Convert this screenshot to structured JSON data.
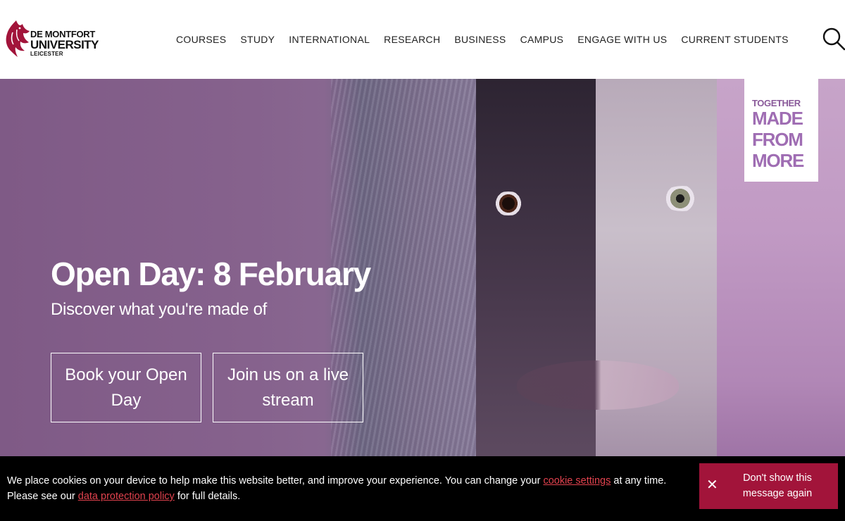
{
  "brand": {
    "line1": "DE MONTFORT",
    "line2": "UNIVERSITY",
    "line3": "LEICESTER",
    "color": "#a2143a"
  },
  "nav": {
    "items": [
      {
        "label": "COURSES"
      },
      {
        "label": "STUDY"
      },
      {
        "label": "INTERNATIONAL"
      },
      {
        "label": "RESEARCH"
      },
      {
        "label": "BUSINESS"
      },
      {
        "label": "CAMPUS"
      },
      {
        "label": "ENGAGE WITH US"
      },
      {
        "label": "CURRENT STUDENTS"
      }
    ],
    "search_icon": "search-icon"
  },
  "hero": {
    "badge": {
      "line1": "TOGETHER",
      "line2": "MADE",
      "line3": "FROM",
      "line4": "MORE"
    },
    "title": "Open Day: 8 February",
    "subtitle": "Discover what you're made of",
    "cta_primary": "Book your Open Day",
    "cta_secondary": "Join us on a live stream"
  },
  "cookie": {
    "text_part1": "We place cookies on your device to help make this website better, and improve your experience. You can change your ",
    "link1": "cookie settings",
    "text_part2": " at any time. Please see our ",
    "link2": "data protection policy",
    "text_part3": " for full details.",
    "dismiss_label": "Don't show this message again",
    "dismiss_icon": "close-icon",
    "accent_color": "#a2143a"
  }
}
